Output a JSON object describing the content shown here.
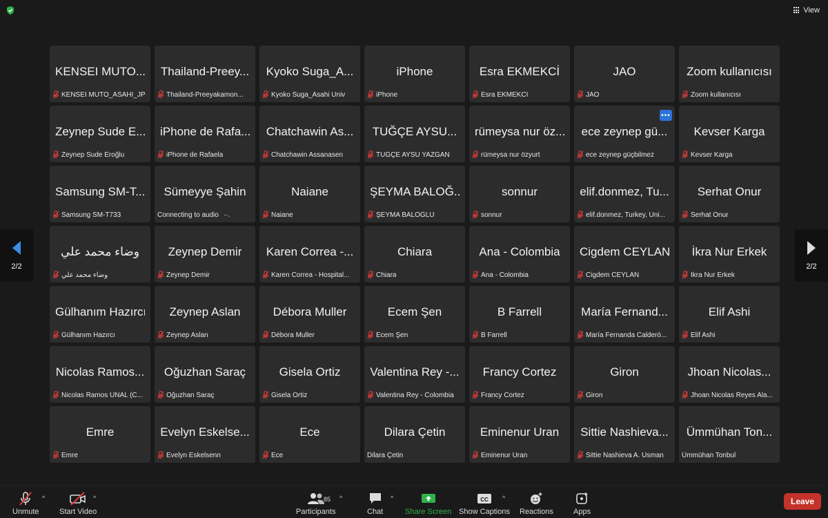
{
  "view_label": "View",
  "pager": {
    "left": "2/2",
    "right": "2/2"
  },
  "toolbar": {
    "unmute": "Unmute",
    "start_video": "Start Video",
    "participants": "Participants",
    "participants_count": "85",
    "chat": "Chat",
    "share_screen": "Share Screen",
    "show_captions": "Show Captions",
    "cc_icon_text": "CC",
    "reactions": "Reactions",
    "apps": "Apps",
    "leave": "Leave"
  },
  "tiles": [
    {
      "name": "KENSEI MUTO...",
      "label": "KENSEI MUTO_ASAHI_JP",
      "muted": true
    },
    {
      "name": "Thailand-Preey...",
      "label": "Thailand-Preeyakamon...",
      "muted": true
    },
    {
      "name": "Kyoko Suga_A...",
      "label": "Kyoko Suga_Asahi Univ",
      "muted": true
    },
    {
      "name": "iPhone",
      "label": "iPhone",
      "muted": true
    },
    {
      "name": "Esra EKMEKCİ",
      "label": "Esra EKMEKCİ",
      "muted": true
    },
    {
      "name": "JAO",
      "label": "JAO",
      "muted": true
    },
    {
      "name": "Zoom kullanıcısı",
      "label": "Zoom kullanıcısı",
      "muted": true
    },
    {
      "name": "Zeynep Sude E...",
      "label": "Zeynep Sude Eroğlu",
      "muted": true
    },
    {
      "name": "iPhone de Rafa...",
      "label": "iPhone de Rafaela",
      "muted": true
    },
    {
      "name": "Chatchawin As...",
      "label": "Chatchawin Assanasen",
      "muted": true
    },
    {
      "name": "TUĞÇE AYSU...",
      "label": "TUĞÇE AYSU YAZGAN",
      "muted": true
    },
    {
      "name": "rümeysa nur öz...",
      "label": "rümeysa nur özyurt",
      "muted": true
    },
    {
      "name": "ece zeynep gü...",
      "label": "ece zeynep güçbilmez",
      "muted": true,
      "more": true
    },
    {
      "name": "Kevser Karga",
      "label": "Kevser Karga",
      "muted": true
    },
    {
      "name": "Samsung SM-T...",
      "label": "Samsung SM-T733",
      "muted": true
    },
    {
      "name": "Sümeyye Şahin",
      "label": "Connecting to audio",
      "muted": false,
      "connecting": true
    },
    {
      "name": "Naiane",
      "label": "Naiane",
      "muted": true
    },
    {
      "name": "ŞEYMA BALOĞ...",
      "label": "ŞEYMA BALOĞLU",
      "muted": true
    },
    {
      "name": "sonnur",
      "label": "sonnur",
      "muted": true
    },
    {
      "name": "elif.donmez, Tu...",
      "label": "elif.donmez, Turkey, Uni...",
      "muted": true
    },
    {
      "name": "Serhat Onur",
      "label": "Serhat Onur",
      "muted": true
    },
    {
      "name": "وضاء محمد علي",
      "label": "وضاء محمد علي",
      "muted": true
    },
    {
      "name": "Zeynep Demir",
      "label": "Zeynep Demir",
      "muted": true
    },
    {
      "name": "Karen Correa -...",
      "label": "Karen Correa - Hospital...",
      "muted": true
    },
    {
      "name": "Chiara",
      "label": "Chiara",
      "muted": true
    },
    {
      "name": "Ana - Colombia",
      "label": "Ana - Colombia",
      "muted": true
    },
    {
      "name": "Cigdem CEYLAN",
      "label": "Cigdem CEYLAN",
      "muted": true
    },
    {
      "name": "İkra Nur Erkek",
      "label": "İkra Nur Erkek",
      "muted": true
    },
    {
      "name": "Gülhanım Hazırcı",
      "label": "Gülhanım Hazırcı",
      "muted": true
    },
    {
      "name": "Zeynep Aslan",
      "label": "Zeynep Aslan",
      "muted": true
    },
    {
      "name": "Débora Muller",
      "label": "Débora Muller",
      "muted": true
    },
    {
      "name": "Ecem Şen",
      "label": "Ecem Şen",
      "muted": true
    },
    {
      "name": "B Farrell",
      "label": "B Farrell",
      "muted": true
    },
    {
      "name": "María Fernand...",
      "label": "María Fernanda Calderó...",
      "muted": true
    },
    {
      "name": "Elif Ashi",
      "label": "Elif Ashi",
      "muted": true
    },
    {
      "name": "Nicolas Ramos...",
      "label": "Nicolas Ramos UNAL (C...",
      "muted": true
    },
    {
      "name": "Oğuzhan Saraç",
      "label": "Oğuzhan Saraç",
      "muted": true
    },
    {
      "name": "Gisela Ortiz",
      "label": "Gisela Ortiz",
      "muted": true
    },
    {
      "name": "Valentina Rey -...",
      "label": "Valentina Rey - Colombia",
      "muted": true
    },
    {
      "name": "Francy Cortez",
      "label": "Francy Cortez",
      "muted": true
    },
    {
      "name": "Giron",
      "label": "Giron",
      "muted": true
    },
    {
      "name": "Jhoan Nicolas...",
      "label": "Jhoan Nicolas Reyes Ala...",
      "muted": true
    },
    {
      "name": "Emre",
      "label": "Emre",
      "muted": true
    },
    {
      "name": "Evelyn  Eskelse...",
      "label": "Evelyn  Eskelsenn",
      "muted": true
    },
    {
      "name": "Ece",
      "label": "Ece",
      "muted": true
    },
    {
      "name": "Dilara Çetin",
      "label": "Dilara Çetin",
      "muted": false
    },
    {
      "name": "Eminenur Uran",
      "label": "Eminenur Uran",
      "muted": true
    },
    {
      "name": "Sittie Nashieva...",
      "label": "Sittie Nashieva A. Usman",
      "muted": true
    },
    {
      "name": "Ümmühan Ton...",
      "label": "Ümmühan Tonbul",
      "muted": false
    }
  ]
}
